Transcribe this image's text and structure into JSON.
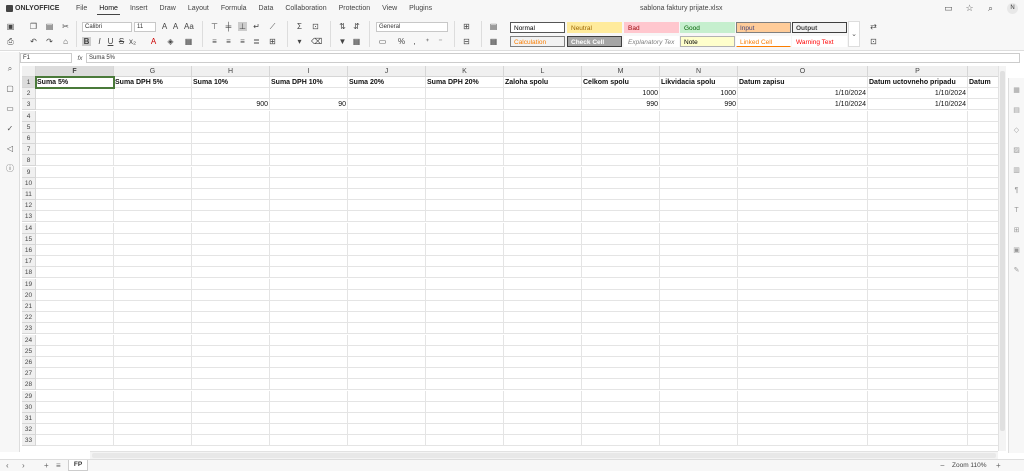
{
  "app": {
    "brand": "ONLYOFFICE",
    "document_title": "sablona faktury prijate.xlsx",
    "user_initial": "N"
  },
  "menu": [
    "File",
    "Home",
    "Insert",
    "Draw",
    "Layout",
    "Formula",
    "Data",
    "Collaboration",
    "Protection",
    "View",
    "Plugins"
  ],
  "active_menu": "Home",
  "toolbar": {
    "font_name": "Calibri",
    "font_size": "11",
    "number_format": "General"
  },
  "cell_styles": [
    {
      "label": "Normal",
      "bg": "#ffffff",
      "fg": "#000000",
      "border": "#555555"
    },
    {
      "label": "Neutral",
      "bg": "#ffeb9c",
      "fg": "#9c6500",
      "border": "#ffeb9c"
    },
    {
      "label": "Bad",
      "bg": "#ffc7ce",
      "fg": "#9c0006",
      "border": "#ffc7ce"
    },
    {
      "label": "Good",
      "bg": "#c6efce",
      "fg": "#006100",
      "border": "#c6efce"
    },
    {
      "label": "Input",
      "bg": "#ffcc99",
      "fg": "#3f3f76",
      "border": "#7f7f7f"
    },
    {
      "label": "Output",
      "bg": "#f2f2f2",
      "fg": "#3f3f3f",
      "border": "#3f3f3f"
    },
    {
      "label": "Calculation",
      "bg": "#f2f2f2",
      "fg": "#fa7d00",
      "border": "#7f7f7f"
    },
    {
      "label": "Check Cell",
      "bg": "#a5a5a5",
      "fg": "#ffffff",
      "border": "#3f3f3f"
    },
    {
      "label": "Explanatory Tex",
      "bg": "#ffffff",
      "fg": "#7f7f7f",
      "border": "#ffffff"
    },
    {
      "label": "Note",
      "bg": "#ffffcc",
      "fg": "#000000",
      "border": "#b2b2b2"
    },
    {
      "label": "Linked Cell",
      "bg": "#ffffff",
      "fg": "#fa7d00",
      "border": "#ffffff"
    },
    {
      "label": "Warning Text",
      "bg": "#ffffff",
      "fg": "#ff0000",
      "border": "#ffffff"
    }
  ],
  "formula_bar": {
    "name_box": "F1",
    "fx_label": "fx",
    "formula": "Suma 5%"
  },
  "columns": [
    "F",
    "G",
    "H",
    "I",
    "J",
    "K",
    "L",
    "M",
    "N",
    "O",
    "P",
    ""
  ],
  "rows": [
    [
      "Suma 5%",
      "Suma DPH 5%",
      "Suma 10%",
      "Suma DPH 10%",
      "Suma 20%",
      "Suma DPH 20%",
      "Zaloha spolu",
      "Celkom spolu",
      "Likvidacia spolu",
      "Datum zapisu",
      "Datum uctovneho pripadu",
      "Datum"
    ],
    [
      "",
      "",
      "",
      "",
      "",
      "",
      "",
      "1000",
      "1000",
      "1/10/2024",
      "1/10/2024",
      ""
    ],
    [
      "",
      "",
      "900",
      "90",
      "",
      "",
      "",
      "990",
      "990",
      "1/10/2024",
      "1/10/2024",
      ""
    ]
  ],
  "row_numbers": [
    "1",
    "2",
    "3",
    "4",
    "5",
    "6",
    "7",
    "8",
    "9",
    "10",
    "11",
    "12",
    "13",
    "14",
    "15",
    "16",
    "17",
    "18",
    "19",
    "20",
    "21",
    "22",
    "23",
    "24",
    "25",
    "26",
    "27",
    "28",
    "29",
    "30",
    "31",
    "32",
    "33"
  ],
  "sheet_tab": "FP",
  "zoom": "Zoom 110%"
}
